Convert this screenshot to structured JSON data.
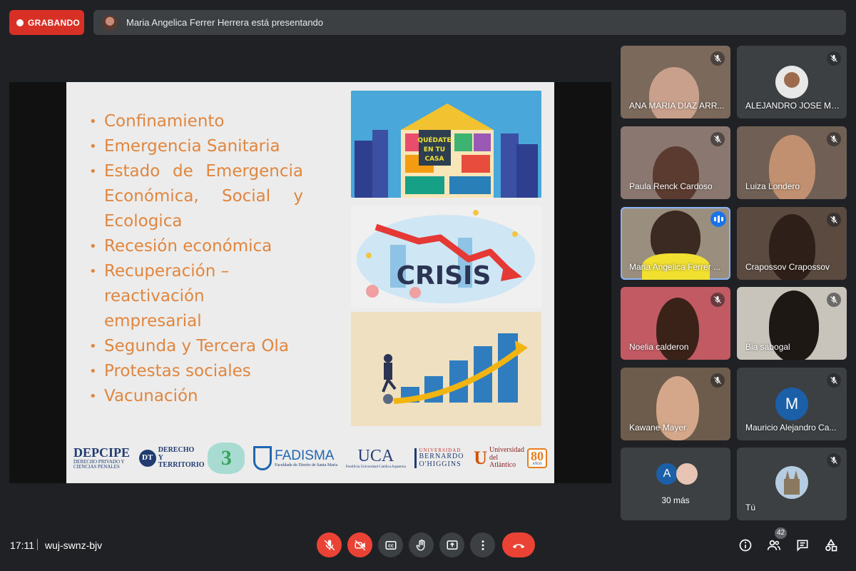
{
  "recording": {
    "label": "GRABANDO",
    "color": "#d93025"
  },
  "presenting_bar": {
    "text": "Maria Angelica Ferrer Herrera está presentando"
  },
  "slide": {
    "bullets": [
      "Confinamiento",
      "Emergencia Sanitaria",
      "Estado de Emergencia Económica, Social y Ecologica",
      "Recesión económica",
      "Recuperación – reactivación empresarial",
      "Segunda y Tercera Ola",
      "Protestas sociales",
      "Vacunación"
    ],
    "image_house_text": "QUÉDATE EN TU CASA",
    "image_crisis_text": "CRISIS",
    "logos": {
      "depcipe": "DEPCIPE",
      "depcipe_sub": "DERECHO PRIVADO Y CIENCIAS PENALES",
      "dt": "DT",
      "dt_text": "DERECHO Y TERRITORIO",
      "s3": "3",
      "fadisma": "FADISMA",
      "fadisma_sub": "Faculdade de Direito de Santa Maria",
      "uca": "UCA",
      "uca_sub": "Pontificia Universidad Católica Argentina",
      "ubo_top": "UNIVERSIDAD",
      "ubo": "BERNARDO O'HIGGINS",
      "uatl": "Universidad del Atlántico",
      "uatl_years": "80",
      "uatl_anos": "AÑOS"
    },
    "accent_color": "#e0863f"
  },
  "participants": [
    {
      "name": "ANA MARIA DIAZ ARR...",
      "muted": true
    },
    {
      "name": "ALEJANDRO JOSE MA...",
      "muted": true
    },
    {
      "name": "Paula Renck Cardoso",
      "muted": true
    },
    {
      "name": "Luiza Londero",
      "muted": true
    },
    {
      "name": "Maria Angelica Ferrer ...",
      "muted": false,
      "speaking": true
    },
    {
      "name": "Crapossov Crapossov",
      "muted": true
    },
    {
      "name": "Noelia calderon",
      "muted": true
    },
    {
      "name": "Bia sabogal",
      "muted": true
    },
    {
      "name": "Kawane Mayer",
      "muted": true
    },
    {
      "name": "Mauricio Alejandro Ca...",
      "muted": true,
      "initial": "M",
      "avatar_color": "#1a5fa8"
    },
    {
      "name": "30 más",
      "initial": "A",
      "avatar_color": "#1a5fa8"
    },
    {
      "name": "Tú",
      "muted": true
    }
  ],
  "bottom_bar": {
    "time": "17:11",
    "separator": "|",
    "meeting_code": "wuj-swnz-bjv",
    "people_count": "42"
  },
  "icons": {
    "mic": "mic-off-icon",
    "camera": "camera-off-icon",
    "captions": "captions-icon",
    "hand": "raise-hand-icon",
    "present": "present-icon",
    "more": "more-options-icon",
    "leave": "leave-call-icon",
    "info": "info-icon",
    "people": "people-icon",
    "chat": "chat-icon",
    "activities": "activities-icon"
  }
}
